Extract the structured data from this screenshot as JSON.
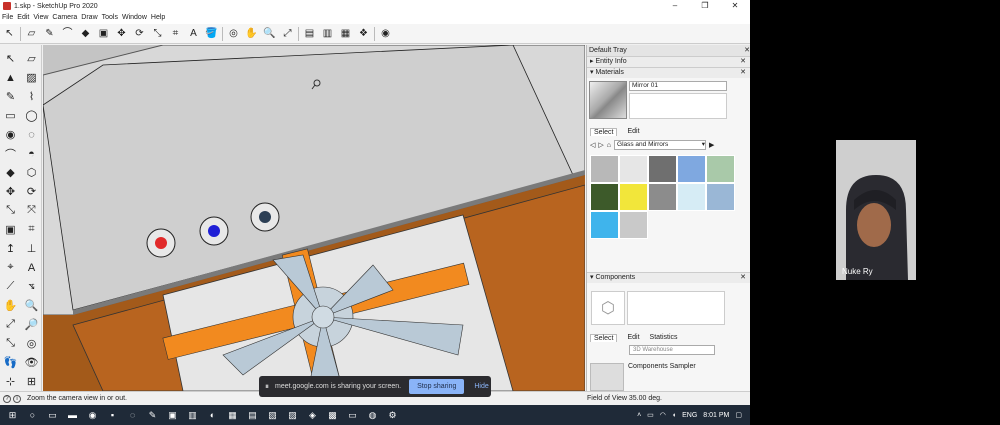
{
  "window": {
    "title": "1.skp - SketchUp Pro 2020",
    "min": "–",
    "max": "❐",
    "close": "✕"
  },
  "menu": [
    "File",
    "Edit",
    "View",
    "Camera",
    "Draw",
    "Tools",
    "Window",
    "Help"
  ],
  "toolbar": [
    {
      "name": "select-icon",
      "glyph": "↖"
    },
    {
      "name": "eraser-icon",
      "glyph": "▱"
    },
    {
      "name": "pencil-icon",
      "glyph": "✎"
    },
    {
      "name": "arc-icon",
      "glyph": "⌒"
    },
    {
      "name": "shape-icon",
      "glyph": "◆"
    },
    {
      "name": "pushpull-icon",
      "glyph": "▣"
    },
    {
      "name": "move-icon",
      "glyph": "✥"
    },
    {
      "name": "rotate-icon",
      "glyph": "⟳"
    },
    {
      "name": "scale-icon",
      "glyph": "⤡"
    },
    {
      "name": "tape-icon",
      "glyph": "⌗"
    },
    {
      "name": "text-icon",
      "glyph": "A"
    },
    {
      "name": "paint-bucket-icon",
      "glyph": "🪣"
    },
    {
      "name": "orbit-icon",
      "glyph": "◎"
    },
    {
      "name": "pan-icon",
      "glyph": "✋"
    },
    {
      "name": "zoom-icon",
      "glyph": "🔍"
    },
    {
      "name": "zoom-extents-icon",
      "glyph": "⤢"
    },
    {
      "name": "warehouse-icon",
      "glyph": "▤"
    },
    {
      "name": "extension-warehouse-icon",
      "glyph": "▥"
    },
    {
      "name": "layout-icon",
      "glyph": "▦"
    },
    {
      "name": "extension-manager-icon",
      "glyph": "❖"
    },
    {
      "name": "account-icon",
      "glyph": "◉"
    }
  ],
  "left_tools": [
    "↖",
    "▱",
    "▲",
    "▨",
    "✎",
    "⌇",
    "▭",
    "◯",
    "◉",
    "◌",
    "⌒",
    "◓",
    "◆",
    "⬡",
    "✥",
    "⟳",
    "⤡",
    "⤧",
    "▣",
    "⌗",
    "↥",
    "⊥",
    "⌖",
    "A",
    "⟋",
    "⦪",
    "✋",
    "🔍",
    "⤢",
    "🔎",
    "⤡",
    "◎",
    "👣",
    "👁",
    "⊹",
    "⊞"
  ],
  "status": {
    "text": "Zoom the camera view in or out.",
    "fov": "Field of View 35.00 deg."
  },
  "tray": {
    "title": "Default Tray",
    "entity_info": "Entity Info",
    "materials": "Materials",
    "material_name": "Mirror 01",
    "tab_select": "Select",
    "tab_edit": "Edit",
    "library": "Glass and Mirrors",
    "components": "Components",
    "tab_statistics": "Statistics",
    "search_placeholder": "3D Warehouse",
    "component_item": "Components Sampler"
  },
  "swatch_colors": [
    "#b8b8b8",
    "#e6e6e6",
    "#6f6f6f",
    "#7fa8e0",
    "#a9c9a9",
    "#3d5a2a",
    "#f2e63a",
    "#8c8c8c",
    "#d6ecf5",
    "#9ab7d6",
    "#3fb4ec",
    "#c9c9c9"
  ],
  "sharebar": {
    "message": "meet.google.com is sharing your screen.",
    "stop": "Stop sharing",
    "hide": "Hide"
  },
  "taskbar": {
    "lang": "ENG",
    "time": "8:01 PM"
  },
  "participant": {
    "name": "Nuke Ry"
  }
}
